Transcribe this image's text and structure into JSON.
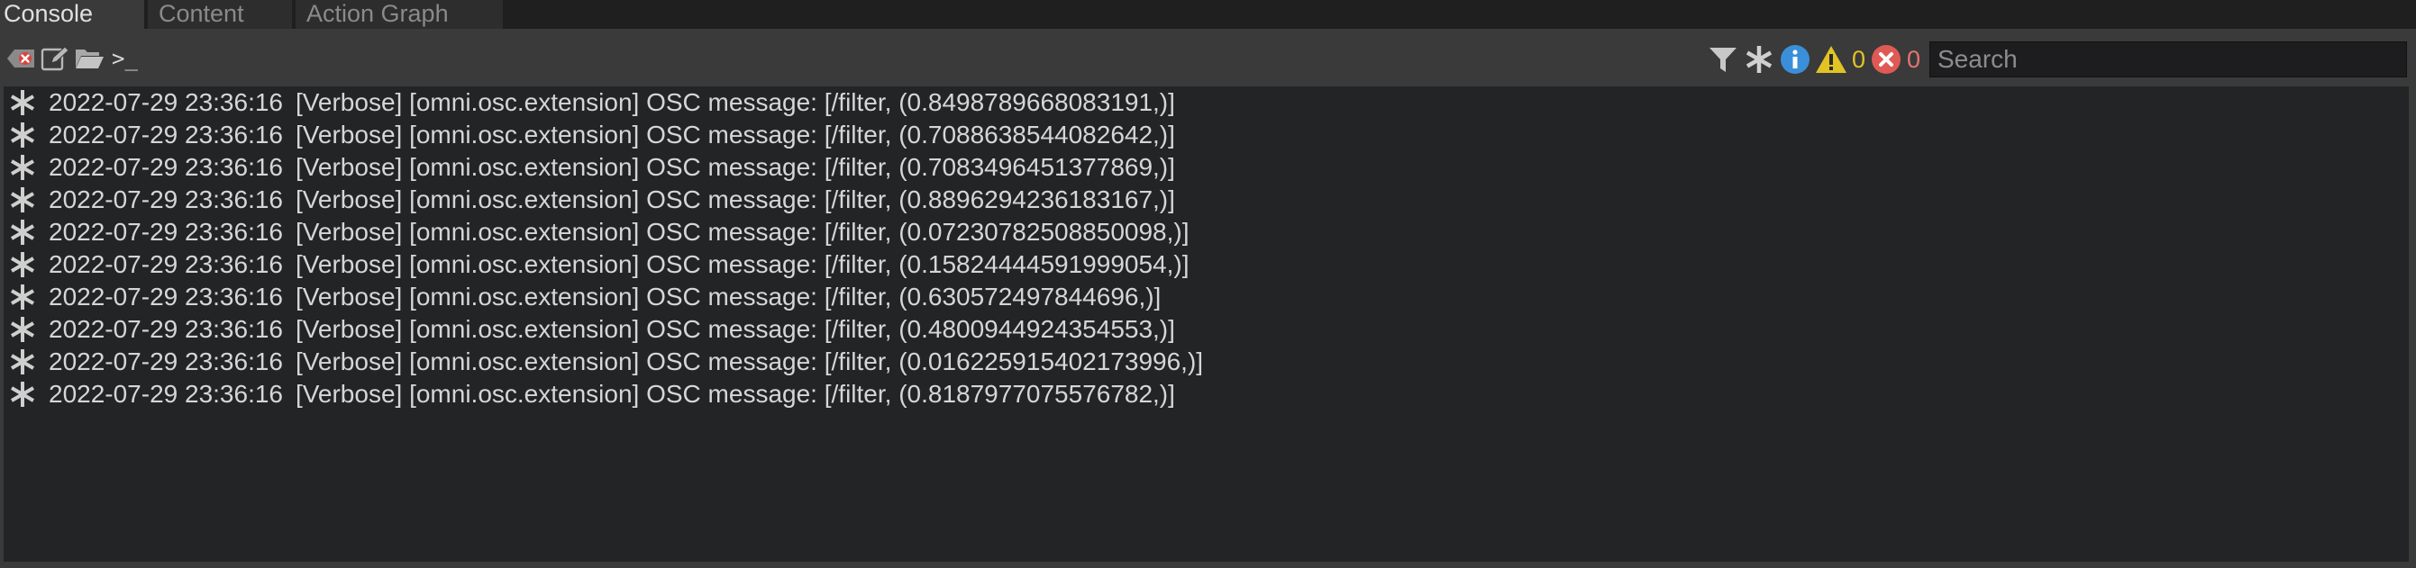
{
  "tabs": [
    {
      "label": "Console",
      "active": true
    },
    {
      "label": "Content",
      "active": false
    },
    {
      "label": "Action Graph",
      "active": false
    }
  ],
  "toolbar": {
    "prompt_label": ">_",
    "icons": [
      "clear-console-icon",
      "edit-icon",
      "open-folder-icon",
      "filter-icon",
      "verbose-icon",
      "info-icon",
      "warning-icon",
      "error-icon"
    ],
    "warning_count": "0",
    "error_count": "0",
    "search_placeholder": "Search"
  },
  "colors": {
    "warning": "#e2c325",
    "error": "#e05a55",
    "info": "#3b8fd9",
    "text": "#d6d6d6"
  },
  "log": {
    "lines": [
      {
        "level_icon": "verbose-asterisk-icon",
        "timestamp": "2022-07-29 23:36:16",
        "message": "[Verbose] [omni.osc.extension] OSC message: [/filter, (0.8498789668083191,)]"
      },
      {
        "level_icon": "verbose-asterisk-icon",
        "timestamp": "2022-07-29 23:36:16",
        "message": "[Verbose] [omni.osc.extension] OSC message: [/filter, (0.7088638544082642,)]"
      },
      {
        "level_icon": "verbose-asterisk-icon",
        "timestamp": "2022-07-29 23:36:16",
        "message": "[Verbose] [omni.osc.extension] OSC message: [/filter, (0.7083496451377869,)]"
      },
      {
        "level_icon": "verbose-asterisk-icon",
        "timestamp": "2022-07-29 23:36:16",
        "message": "[Verbose] [omni.osc.extension] OSC message: [/filter, (0.8896294236183167,)]"
      },
      {
        "level_icon": "verbose-asterisk-icon",
        "timestamp": "2022-07-29 23:36:16",
        "message": "[Verbose] [omni.osc.extension] OSC message: [/filter, (0.07230782508850098,)]"
      },
      {
        "level_icon": "verbose-asterisk-icon",
        "timestamp": "2022-07-29 23:36:16",
        "message": "[Verbose] [omni.osc.extension] OSC message: [/filter, (0.15824444591999054,)]"
      },
      {
        "level_icon": "verbose-asterisk-icon",
        "timestamp": "2022-07-29 23:36:16",
        "message": "[Verbose] [omni.osc.extension] OSC message: [/filter, (0.630572497844696,)]"
      },
      {
        "level_icon": "verbose-asterisk-icon",
        "timestamp": "2022-07-29 23:36:16",
        "message": "[Verbose] [omni.osc.extension] OSC message: [/filter, (0.4800944924354553,)]"
      },
      {
        "level_icon": "verbose-asterisk-icon",
        "timestamp": "2022-07-29 23:36:16",
        "message": "[Verbose] [omni.osc.extension] OSC message: [/filter, (0.016225915402173996,)]"
      },
      {
        "level_icon": "verbose-asterisk-icon",
        "timestamp": "2022-07-29 23:36:16",
        "message": "[Verbose] [omni.osc.extension] OSC message: [/filter, (0.8187977075576782,)]"
      }
    ]
  }
}
